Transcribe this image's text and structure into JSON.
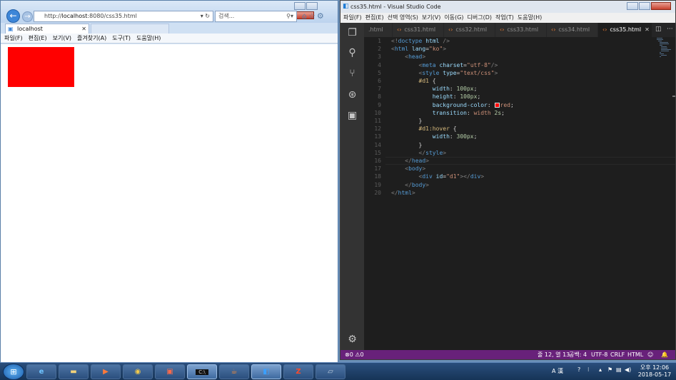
{
  "ie": {
    "address": "http://localhost:8080/css35.html",
    "address_prefix": "http://",
    "address_host": "localhost",
    "address_rest": ":8080/css35.html",
    "search_placeholder": "검색...",
    "tab_label": "localhost",
    "menu": [
      "파일(F)",
      "편집(E)",
      "보기(V)",
      "즐겨찾기(A)",
      "도구(T)",
      "도움말(H)"
    ],
    "page_box_color": "#ff0000"
  },
  "vscode": {
    "title": "css35.html - Visual Studio Code",
    "menu": [
      "파일(F)",
      "편집(E)",
      "선택 영역(S)",
      "보기(V)",
      "이동(G)",
      "디버그(D)",
      "작업(T)",
      "도움말(H)"
    ],
    "tabs": [
      ".html",
      "css31.html",
      "css32.html",
      "css33.html",
      "css34.html",
      "css35.html"
    ],
    "active_tab": "css35.html",
    "code_lines": [
      "<!doctype html />",
      "<html lang=\"ko\">",
      "<head>",
      "<meta charset=\"utf-8\"/>",
      "<style type=\"text/css\">",
      "#d1 {",
      "width: 100px;",
      "height: 100px;",
      "background-color: red;",
      "transition: width 2s;",
      "}",
      "#d1:hover {",
      "width: 300px;",
      "}",
      "</style>",
      "</head>",
      "<body>",
      "<div id=\"d1\"></div>",
      "</body>",
      "</html>"
    ],
    "status": {
      "problems": "0",
      "warnings": "0",
      "position": "줄 12, 열 13",
      "indent": "공백: 4",
      "encoding": "UTF-8",
      "eol": "CRLF",
      "language": "HTML"
    },
    "colors": {
      "statusbar": "#68217a",
      "background": "#1e1e1e"
    }
  },
  "taskbar": {
    "items": [
      "ie-icon",
      "explorer-icon",
      "media-icon",
      "chrome-icon",
      "app-icon",
      "cmd-icon",
      "java-icon",
      "vscode-icon",
      "filezilla-icon",
      "misc-icon"
    ],
    "ime": "A 漢",
    "time": "오후 12:06",
    "date": "2018-05-17"
  }
}
